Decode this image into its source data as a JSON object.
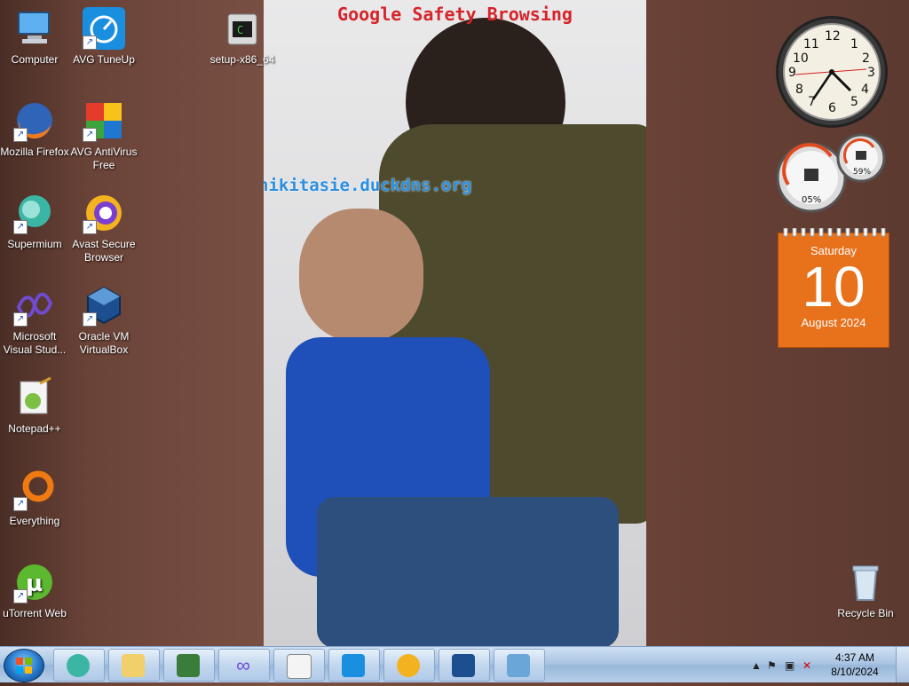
{
  "wallpaper": {
    "title_text": "Google Safety Browsing",
    "url_text": "nikitasie.duckdns.org"
  },
  "desktop_icons": [
    {
      "label": "Computer"
    },
    {
      "label": "AVG TuneUp"
    },
    {
      "label": "setup-x86_64"
    },
    {
      "label": "Mozilla Firefox"
    },
    {
      "label": "AVG AntiVirus Free"
    },
    {
      "label": "Supermium"
    },
    {
      "label": "Avast Secure Browser"
    },
    {
      "label": "Microsoft Visual Stud..."
    },
    {
      "label": "Oracle VM VirtualBox"
    },
    {
      "label": "Notepad++"
    },
    {
      "label": "Everything"
    },
    {
      "label": "uTorrent Web"
    },
    {
      "label": "Recycle Bin"
    }
  ],
  "gadgets": {
    "clock": {
      "numerals": [
        "12",
        "1",
        "2",
        "3",
        "4",
        "5",
        "6",
        "7",
        "8",
        "9",
        "10",
        "11"
      ]
    },
    "meter": {
      "cpu": "05%",
      "memory": "59%"
    },
    "calendar": {
      "weekday": "Saturday",
      "day": "10",
      "month_year": "August 2024"
    }
  },
  "taskbar": {
    "buttons": [
      {
        "icon": "supermium-icon"
      },
      {
        "icon": "folder-icon"
      },
      {
        "icon": "task-manager-icon"
      },
      {
        "icon": "visual-studio-icon"
      },
      {
        "icon": "notepadpp-icon"
      },
      {
        "icon": "avg-tuneup-icon"
      },
      {
        "icon": "avast-browser-icon"
      },
      {
        "icon": "virtualbox-icon"
      },
      {
        "icon": "image-viewer-icon"
      }
    ],
    "clock": {
      "time": "4:37 AM",
      "date": "8/10/2024"
    },
    "tray_expand": "▲"
  }
}
